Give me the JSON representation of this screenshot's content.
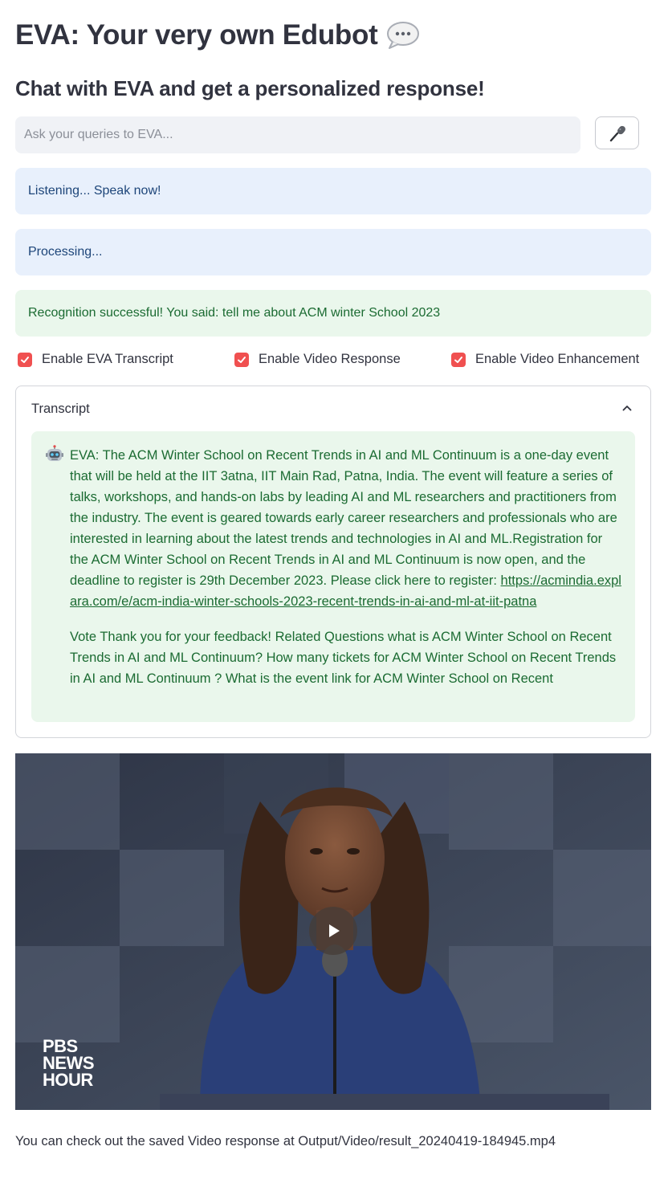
{
  "header": {
    "title": "EVA: Your very own Edubot",
    "subtitle": "Chat with EVA and get a personalized response!"
  },
  "query": {
    "placeholder": "Ask your queries to EVA...",
    "value": ""
  },
  "mic_button": {
    "icon": "microphone-icon"
  },
  "alerts": {
    "listening": "Listening... Speak now!",
    "processing": "Processing...",
    "success": "Recognition successful! You said: tell me about ACM winter School 2023"
  },
  "options": {
    "transcript_label": "Enable EVA Transcript",
    "transcript_checked": true,
    "video_response_label": "Enable Video Response",
    "video_response_checked": true,
    "video_enhancement_label": "Enable Video Enhancement",
    "video_enhancement_checked": true
  },
  "transcript": {
    "label": "Transcript",
    "expanded": true,
    "avatar_icon": "robot-icon",
    "text": "EVA: The ACM Winter School on Recent Trends in AI and ML Continuum is a one-day event that will be held at the IIT 3atna, IIT Main Rad, Patna, India. The event will feature a series of talks, workshops, and hands-on labs by leading AI and ML researchers and practitioners from the industry. The event is geared towards early career researchers and professionals who are interested in learning about the latest trends and technologies in AI and ML.Registration for the ACM Winter School on Recent Trends in AI and ML Continuum is now open, and the deadline to register is 29th December 2023. Please click here to register:",
    "link": "https://acmindia.explara.com/e/acm-india-winter-schools-2023-recent-trends-in-ai-and-ml-at-iit-patna",
    "followup": "Vote Thank you for your feedback! Related Questions what is ACM Winter School on Recent Trends in AI and ML Continuum? How many tickets for ACM Winter School on Recent Trends in AI and ML Continuum ? What is the event link for ACM Winter School on Recent"
  },
  "video": {
    "watermark_line1": "PBS",
    "watermark_line2": "NEWS",
    "watermark_line3": "HOUR"
  },
  "footer": {
    "text": "You can check out the saved Video response at Output/Video/result_20240419-184945.mp4"
  },
  "colors": {
    "checkbox": "#f05050",
    "info_bg": "#e8f0fc",
    "info_text": "#1d4579",
    "success_bg": "#eaf7ec",
    "success_text": "#1b6b32"
  }
}
